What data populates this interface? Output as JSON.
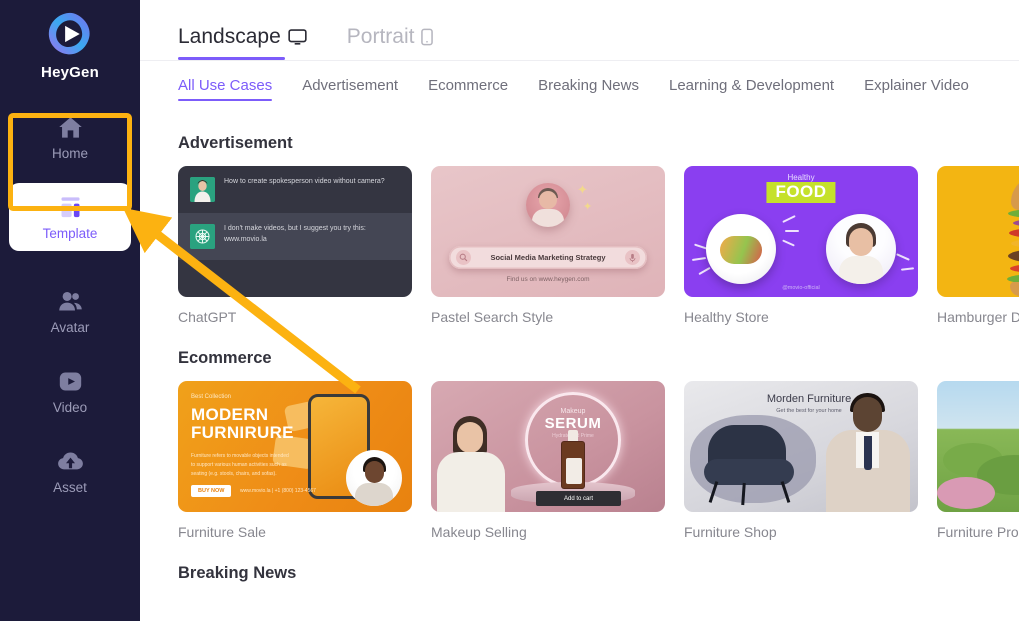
{
  "sidebar": {
    "brand": "HeyGen",
    "logo_icon": "heygen-play-logo",
    "items": [
      {
        "label": "Home",
        "icon": "home-icon",
        "active": false
      },
      {
        "label": "Template",
        "icon": "template-layout-icon",
        "active": true
      },
      {
        "label": "Avatar",
        "icon": "people-icon",
        "active": false
      },
      {
        "label": "Video",
        "icon": "play-square-icon",
        "active": false
      },
      {
        "label": "Asset",
        "icon": "cloud-upload-icon",
        "active": false
      }
    ]
  },
  "colors": {
    "sidebar_bg": "#1c1b3a",
    "accent_purple": "#7c5cfa",
    "highlight_yellow": "#fcb211",
    "muted_text": "#87878f"
  },
  "mode_tabs": [
    {
      "label": "Landscape",
      "icon": "monitor-icon",
      "active": true
    },
    {
      "label": "Portrait",
      "icon": "phone-icon",
      "active": false
    }
  ],
  "categories": [
    {
      "label": "All Use Cases",
      "active": true
    },
    {
      "label": "Advertisement",
      "active": false
    },
    {
      "label": "Ecommerce",
      "active": false
    },
    {
      "label": "Breaking News",
      "active": false
    },
    {
      "label": "Learning & Development",
      "active": false
    },
    {
      "label": "Explainer Video",
      "active": false
    }
  ],
  "sections": [
    {
      "title": "Advertisement",
      "cards": [
        {
          "label": "ChatGPT",
          "thumb": {
            "style": "chatgpt",
            "messages": [
              {
                "text": "How to create spokesperson video without camera?"
              },
              {
                "text": "I don't make videos, but I suggest you try this: www.movio.la"
              }
            ]
          }
        },
        {
          "label": "Pastel Search Style",
          "thumb": {
            "style": "pastel-search",
            "query": "Social Media Marketing Strategy",
            "footer": "Find us on www.heygen.com"
          }
        },
        {
          "label": "Healthy Store",
          "thumb": {
            "style": "healthy-food",
            "kicker": "Healthy",
            "headline": "FOOD",
            "handle": "@movio-official"
          }
        },
        {
          "label": "Hamburger Delivery",
          "thumb": {
            "style": "hamburger"
          }
        }
      ]
    },
    {
      "title": "Ecommerce",
      "cards": [
        {
          "label": "Furniture Sale",
          "thumb": {
            "style": "furniture-sale",
            "kicker": "Best Collection",
            "headline_line1": "MODERN",
            "headline_line2": "FURNIRURE",
            "body": "Furniture refers to movable objects intended to support various human activities such as seating (e.g. stools, chairs, and sofas).",
            "button": "BUY NOW",
            "contact": "www.movio.la  |  +1 (800) 123-4567"
          }
        },
        {
          "label": "Makeup Selling",
          "thumb": {
            "style": "makeup",
            "kicker": "Makeup",
            "headline": "SERUM",
            "sub": "Hydrate and Prime",
            "button": "Add to cart"
          }
        },
        {
          "label": "Furniture Shop",
          "thumb": {
            "style": "furniture-shop",
            "headline": "Morden Furniture",
            "sub": "Get the best for your home"
          }
        },
        {
          "label": "Furniture Promo",
          "thumb": {
            "style": "garden"
          }
        }
      ]
    },
    {
      "title": "Breaking News",
      "cards": []
    }
  ],
  "annotation": {
    "type": "arrow-and-box",
    "target": "sidebar-item-home",
    "color": "#fcb211"
  }
}
